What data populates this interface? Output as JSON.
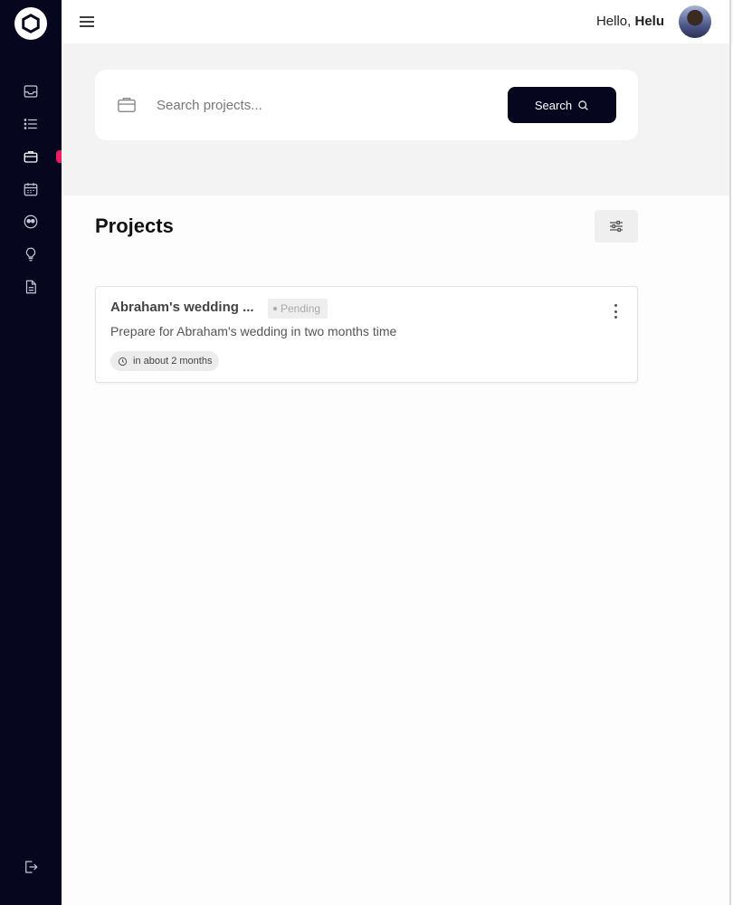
{
  "header": {
    "greeting_prefix": "Hello, ",
    "user_name": "Helu"
  },
  "search": {
    "placeholder": "Search projects...",
    "button_label": "Search"
  },
  "projects_section": {
    "title": "Projects"
  },
  "projects": [
    {
      "title": "Abraham's wedding ...",
      "status": "Pending",
      "description": "Prepare for Abraham's wedding in two months time",
      "due": "in about 2 months"
    }
  ],
  "sidebar": {
    "items": [
      {
        "icon": "inbox-icon"
      },
      {
        "icon": "list-icon"
      },
      {
        "icon": "briefcase-icon",
        "active": true
      },
      {
        "icon": "calendar-icon"
      },
      {
        "icon": "people-icon"
      },
      {
        "icon": "lightbulb-icon"
      },
      {
        "icon": "document-icon"
      }
    ],
    "bottom": {
      "icon": "logout-icon"
    }
  },
  "colors": {
    "sidebar_bg": "#06061e",
    "accent": "#e91e63",
    "button_bg": "#06061e"
  }
}
